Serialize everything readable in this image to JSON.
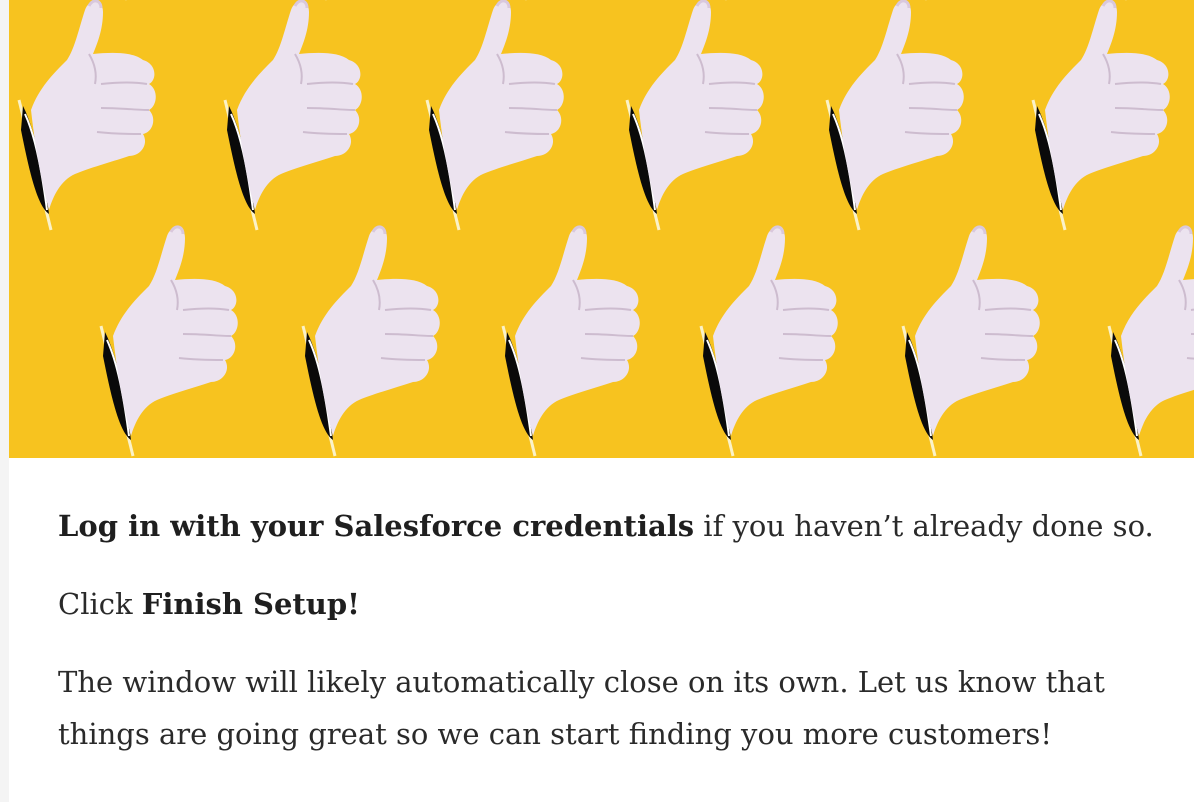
{
  "hero": {
    "icon": "thumbs-up-icon",
    "background_color": "#f7c31f"
  },
  "content": {
    "p1_bold": "Log in with your Salesforce credentials",
    "p1_rest": " if you haven’t already done so.",
    "p2_prefix": "Click ",
    "p2_bold": "Finish Setup!",
    "p3": "The window will likely automatically close on its own. Let us know that things are going great so we can start finding you more customers!"
  }
}
